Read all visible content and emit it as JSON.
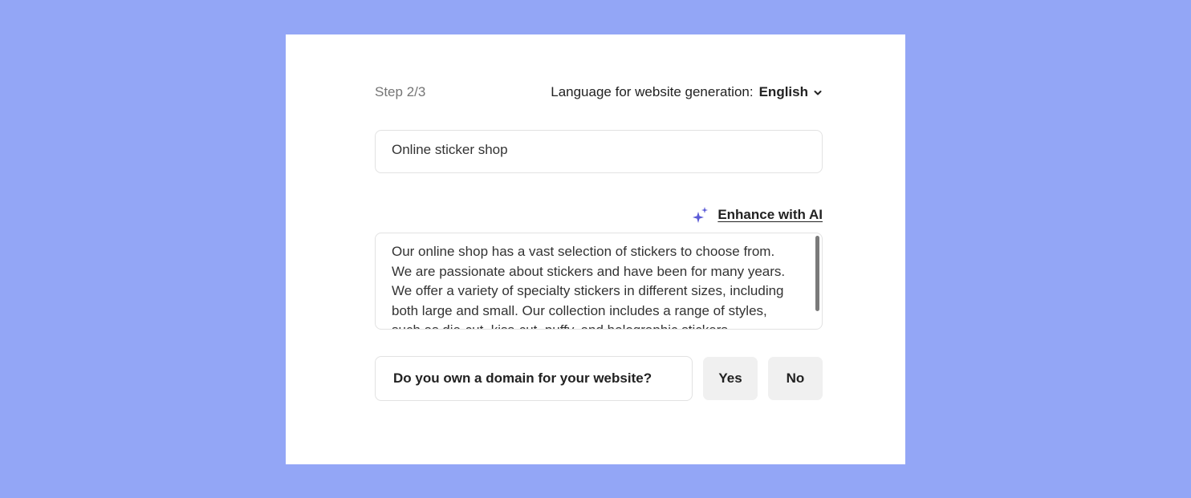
{
  "header": {
    "step": "Step 2/3",
    "language_label": "Language for website generation:",
    "language_value": "English"
  },
  "business_name": {
    "value": "Online sticker shop"
  },
  "enhance": {
    "label": "Enhance with AI",
    "icon": "sparkles-icon",
    "icon_color": "#5b5bd6"
  },
  "description": {
    "value": "Our online shop has a vast selection of stickers to choose from. We are passionate about stickers and have been for many years. We offer a variety of specialty stickers in different sizes, including both large and small. Our collection includes a range of styles, such as die-cut, kiss-cut, puffy, and holographic stickers."
  },
  "domain": {
    "question": "Do you own a domain for your website?",
    "yes_label": "Yes",
    "no_label": "No"
  },
  "colors": {
    "background": "#93a6f6",
    "card": "#ffffff",
    "button": "#f0f0f0"
  }
}
